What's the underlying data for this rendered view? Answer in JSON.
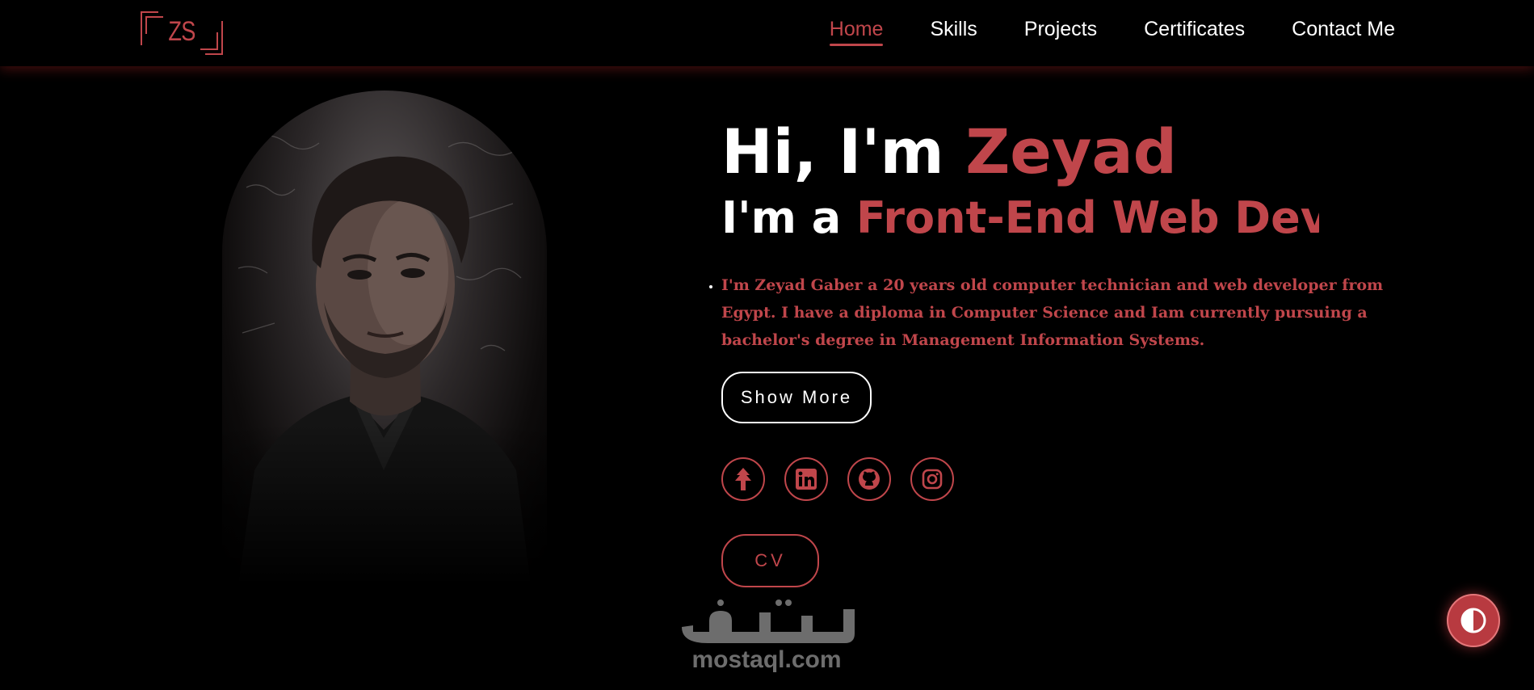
{
  "logo": {
    "text": "ZS"
  },
  "nav": {
    "items": [
      {
        "label": "Home",
        "active": true
      },
      {
        "label": "Skills",
        "active": false
      },
      {
        "label": "Projects",
        "active": false
      },
      {
        "label": "Certificates",
        "active": false
      },
      {
        "label": "Contact Me",
        "active": false
      }
    ]
  },
  "hero": {
    "greeting_prefix": "Hi, I'm",
    "name": "Zeyad",
    "role_prefix": "I'm a",
    "role": "Front-End Web Devel",
    "bio": "I'm Zeyad Gaber a 20 years old computer technician and web developer from Egypt. I have a diploma in Computer Science and Iam currently pursuing a bachelor's degree in Management Information Systems.",
    "show_more_label": "Show More",
    "cv_label": "CV"
  },
  "socials": [
    {
      "icon": "linktree-icon"
    },
    {
      "icon": "linkedin-icon"
    },
    {
      "icon": "github-icon"
    },
    {
      "icon": "instagram-icon"
    }
  ],
  "watermark": {
    "text": "mostaql.com"
  },
  "colors": {
    "accent": "#c0464b",
    "background": "#000000",
    "text": "#ffffff"
  }
}
